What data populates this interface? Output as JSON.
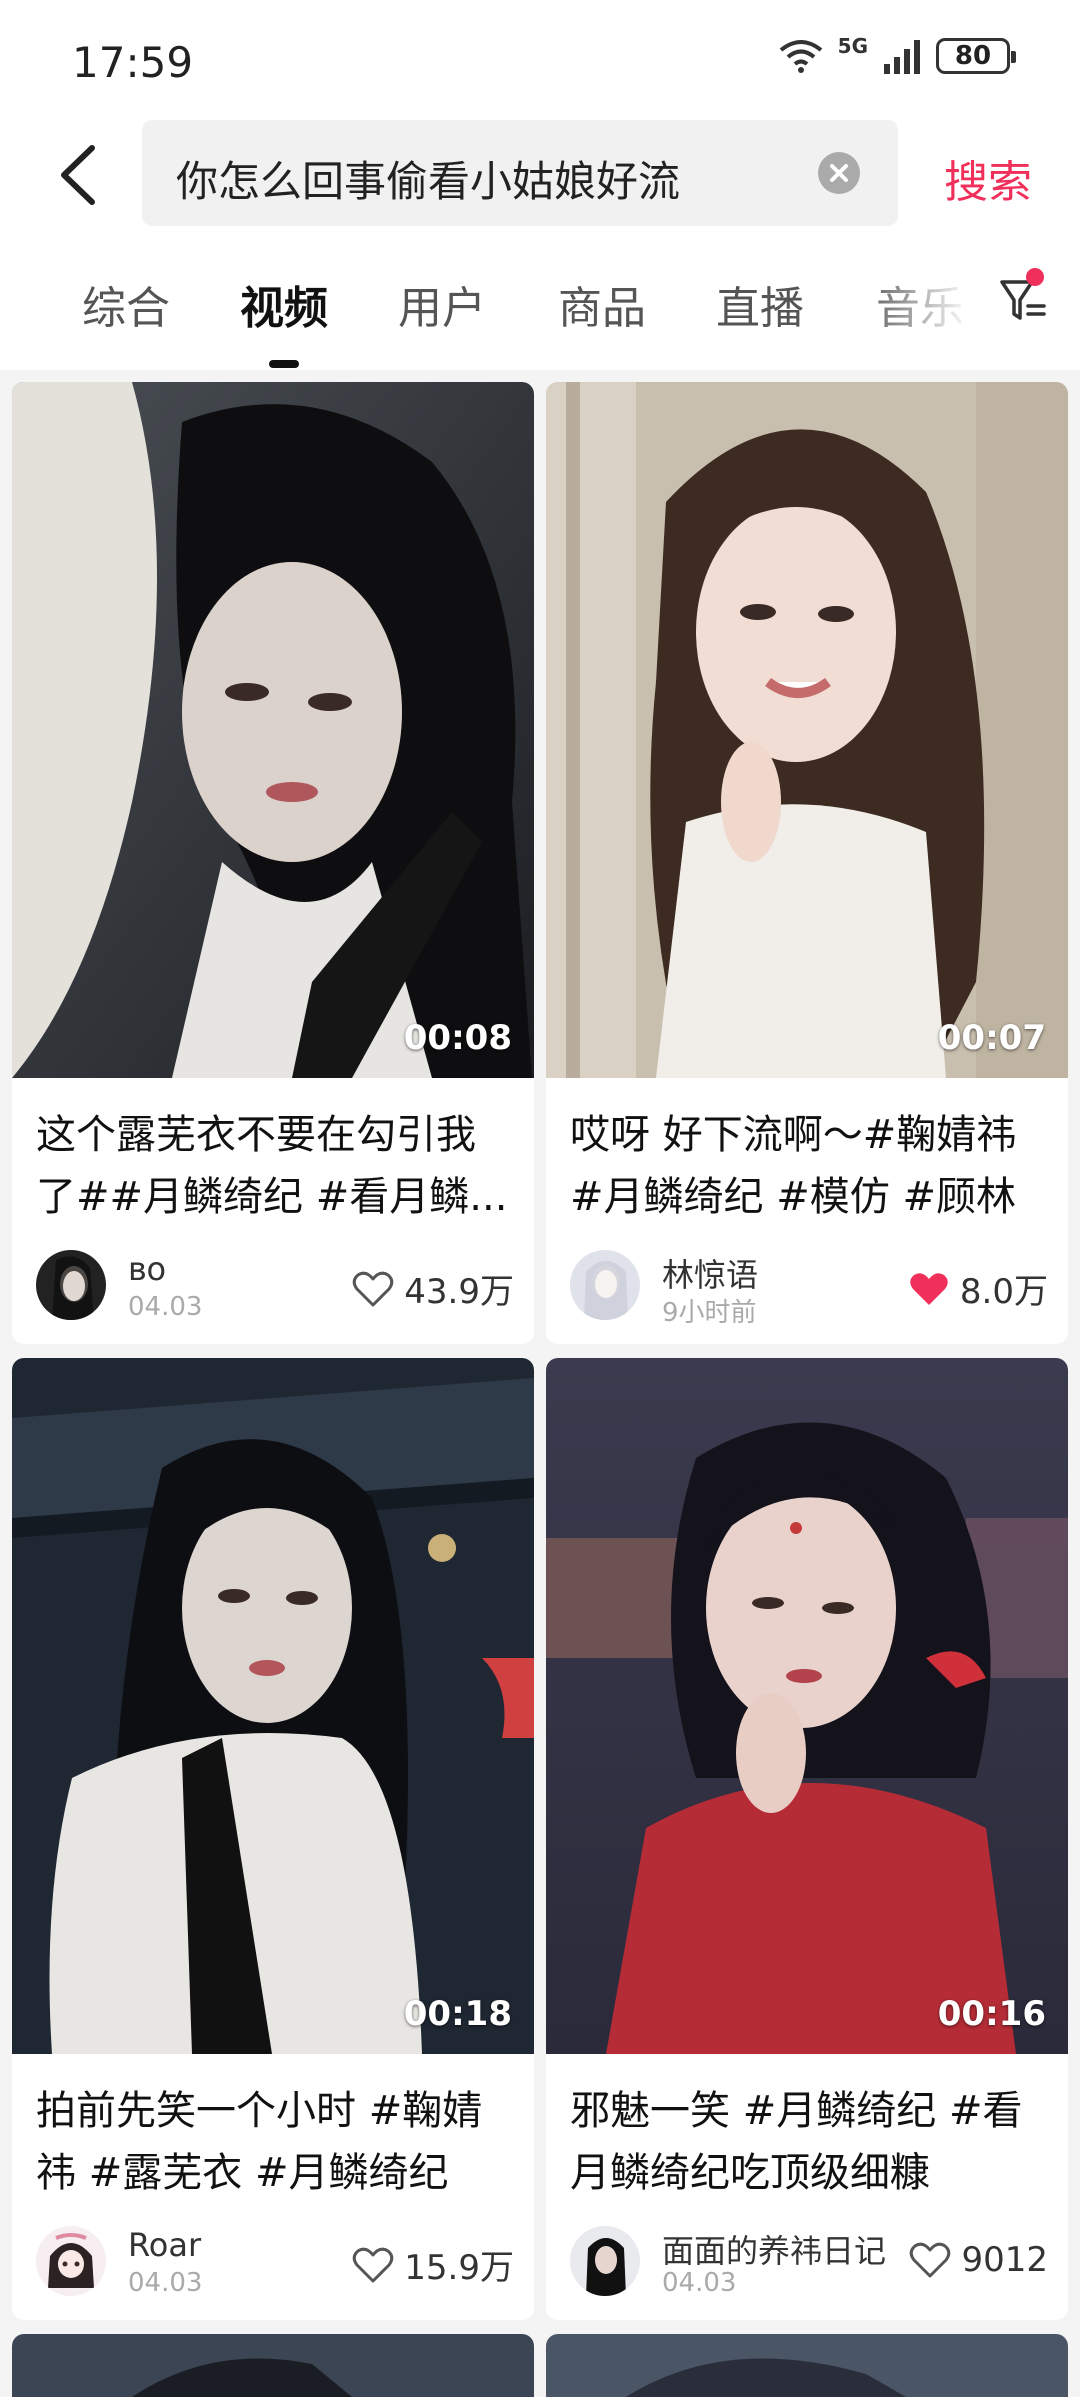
{
  "status_bar": {
    "time": "17:59",
    "network": "5G",
    "battery": "80"
  },
  "search": {
    "query": "你怎么回事偷看小姑娘好流",
    "button_label": "搜索"
  },
  "tabs": [
    {
      "label": "综合"
    },
    {
      "label": "视频"
    },
    {
      "label": "用户"
    },
    {
      "label": "商品"
    },
    {
      "label": "直播"
    },
    {
      "label": "音乐"
    }
  ],
  "active_tab": "视频",
  "colors": {
    "accent": "#f0305a",
    "liked_heart": "#f0305a"
  },
  "videos": [
    {
      "duration": "00:08",
      "title": "这个露芜衣不要在勾引我了##月鳞绮纪 #看月鳞...",
      "author": "ʙᴏ",
      "date": "04.03",
      "likes": "43.9万",
      "liked": false
    },
    {
      "duration": "00:07",
      "title": "哎呀 好下流啊～#鞠婧祎 #月鳞绮纪 #模仿 #顾林",
      "author": "林惊语",
      "date": "9小时前",
      "likes": "8.0万",
      "liked": true
    },
    {
      "duration": "00:18",
      "title": "拍前先笑一个小时 #鞠婧祎 #露芜衣 #月鳞绮纪#...",
      "author": "Roar",
      "date": "04.03",
      "likes": "15.9万",
      "liked": false
    },
    {
      "duration": "00:16",
      "title": "邪魅一笑 #月鳞绮纪 #看月鳞绮纪吃顶级细糠",
      "author": "面面的养祎日记",
      "date": "04.03",
      "likes": "9012",
      "liked": false
    }
  ]
}
